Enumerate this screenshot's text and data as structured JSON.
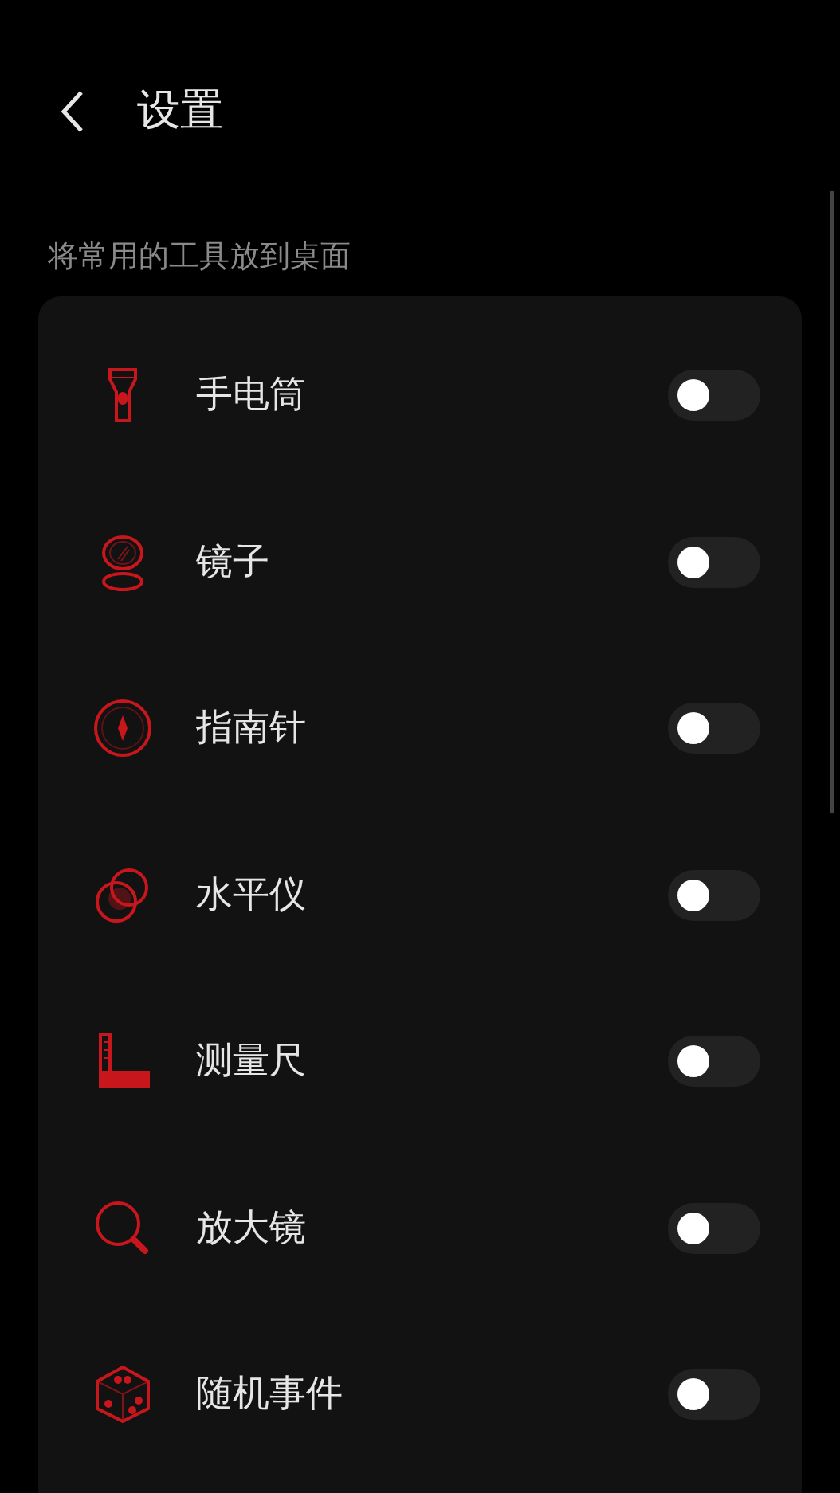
{
  "header": {
    "title": "设置"
  },
  "section": {
    "label": "将常用的工具放到桌面"
  },
  "tools": [
    {
      "kind": "flashlight",
      "name": "手电筒",
      "on": false
    },
    {
      "kind": "mirror",
      "name": "镜子",
      "on": false
    },
    {
      "kind": "compass",
      "name": "指南针",
      "on": false
    },
    {
      "kind": "level",
      "name": "水平仪",
      "on": false
    },
    {
      "kind": "ruler",
      "name": "测量尺",
      "on": false
    },
    {
      "kind": "magnifier",
      "name": "放大镜",
      "on": false
    },
    {
      "kind": "dice",
      "name": "随机事件",
      "on": false
    }
  ]
}
